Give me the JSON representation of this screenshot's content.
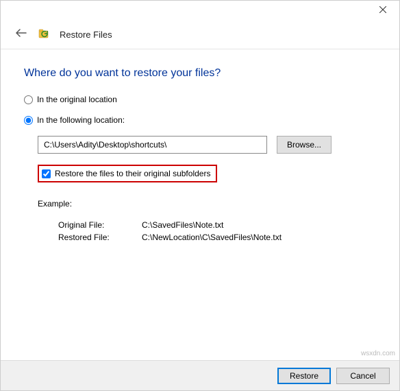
{
  "window": {
    "title": "Restore Files"
  },
  "heading": "Where do you want to restore your files?",
  "options": {
    "original_location": "In the original location",
    "following_location": "In the following location:"
  },
  "path": {
    "value": "C:\\Users\\Adity\\Desktop\\shortcuts\\",
    "browse_label": "Browse..."
  },
  "checkbox": {
    "restore_subfolders": "Restore the files to their original subfolders"
  },
  "example": {
    "header": "Example:",
    "original_label": "Original File:",
    "original_value": "C:\\SavedFiles\\Note.txt",
    "restored_label": "Restored File:",
    "restored_value": "C:\\NewLocation\\C\\SavedFiles\\Note.txt"
  },
  "footer": {
    "restore": "Restore",
    "cancel": "Cancel"
  },
  "watermark": "wsxdn.com"
}
